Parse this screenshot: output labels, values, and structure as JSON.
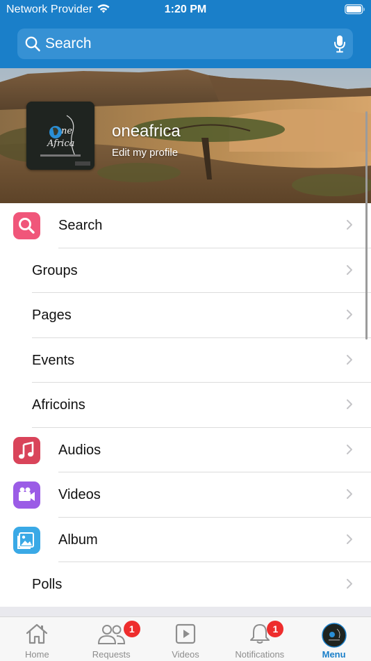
{
  "status_bar": {
    "carrier": "Network Provider",
    "time": "1:20 PM"
  },
  "search": {
    "placeholder": "Search"
  },
  "profile": {
    "name": "oneafrica",
    "edit_link": "Edit my profile",
    "avatar_logo_text": "One Africa"
  },
  "menu": {
    "items": [
      {
        "label": "Search",
        "icon": "search-icon",
        "color": "#f0567a"
      },
      {
        "label": "Groups"
      },
      {
        "label": "Pages"
      },
      {
        "label": "Events"
      },
      {
        "label": "Africoins"
      },
      {
        "label": "Audios",
        "icon": "music-note-icon",
        "color": "#d9445a"
      },
      {
        "label": "Videos",
        "icon": "video-camera-icon",
        "color": "#9b5ce6"
      },
      {
        "label": "Album",
        "icon": "photo-album-icon",
        "color": "#3aa9e6"
      },
      {
        "label": "Polls"
      }
    ]
  },
  "tabbar": {
    "tabs": [
      {
        "label": "Home",
        "icon": "home-icon"
      },
      {
        "label": "Requests",
        "icon": "people-icon",
        "badge": "1"
      },
      {
        "label": "Videos",
        "icon": "play-icon"
      },
      {
        "label": "Notifications",
        "icon": "bell-icon",
        "badge": "1"
      },
      {
        "label": "Menu",
        "icon": "avatar-icon",
        "active": true
      }
    ]
  },
  "colors": {
    "header": "#1a7fc9",
    "active_tab": "#1a7fc9",
    "badge": "#ee2d2d"
  }
}
